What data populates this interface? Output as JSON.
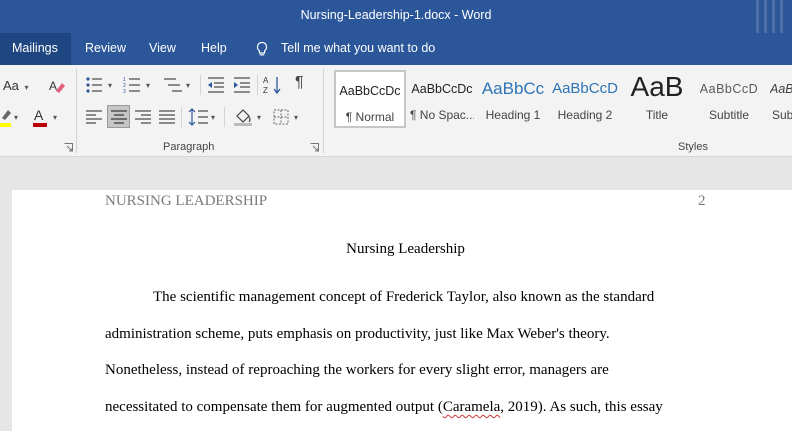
{
  "window": {
    "title": "Nursing-Leadership-1.docx  -  Word"
  },
  "tabs": [
    {
      "label": "Mailings",
      "active": true
    },
    {
      "label": "Review",
      "active": false
    },
    {
      "label": "View",
      "active": false
    },
    {
      "label": "Help",
      "active": false
    }
  ],
  "tell_me": {
    "text": "Tell me what you want to do",
    "icon": "lightbulb-icon"
  },
  "ribbon": {
    "font_group": {
      "change_case_label": "Aa"
    },
    "paragraph_group": {
      "label": "Paragraph",
      "alignment_selected": "center"
    },
    "styles_group": {
      "label": "Styles",
      "items": [
        {
          "preview": "AaBbCcDc",
          "name": "¶ Normal",
          "selected": true
        },
        {
          "preview": "AaBbCcDc",
          "name": "¶ No Spac...",
          "selected": false
        },
        {
          "preview": "AaBbCc",
          "name": "Heading 1",
          "selected": false
        },
        {
          "preview": "AaBbCcD",
          "name": "Heading 2",
          "selected": false
        },
        {
          "preview": "AaB",
          "name": "Title",
          "selected": false
        },
        {
          "preview": "AaBbCcD",
          "name": "Subtitle",
          "selected": false
        },
        {
          "preview": "AaBbCcDd",
          "name": "Subtle",
          "selected": false
        }
      ]
    },
    "colors": {
      "highlight": "#ffff00",
      "font_color": "#c00000"
    }
  },
  "document": {
    "running_head": "NURSING LEADERSHIP",
    "page_number": "2",
    "title": "Nursing Leadership",
    "lines": [
      "The scientific management concept of Frederick Taylor, also known as the standard",
      "administration scheme, puts emphasis on productivity, just like Max Weber's theory.",
      "Nonetheless, instead of reproaching the workers for every slight error, managers are"
    ],
    "last_line": {
      "before": "necessitated to compensate them for augmented output (",
      "misspelled": "Caramela",
      "after": ", 2019). As such, this essay"
    }
  },
  "theme": {
    "accent": "#2b579a",
    "spellcheck_underline": "#d13438"
  }
}
